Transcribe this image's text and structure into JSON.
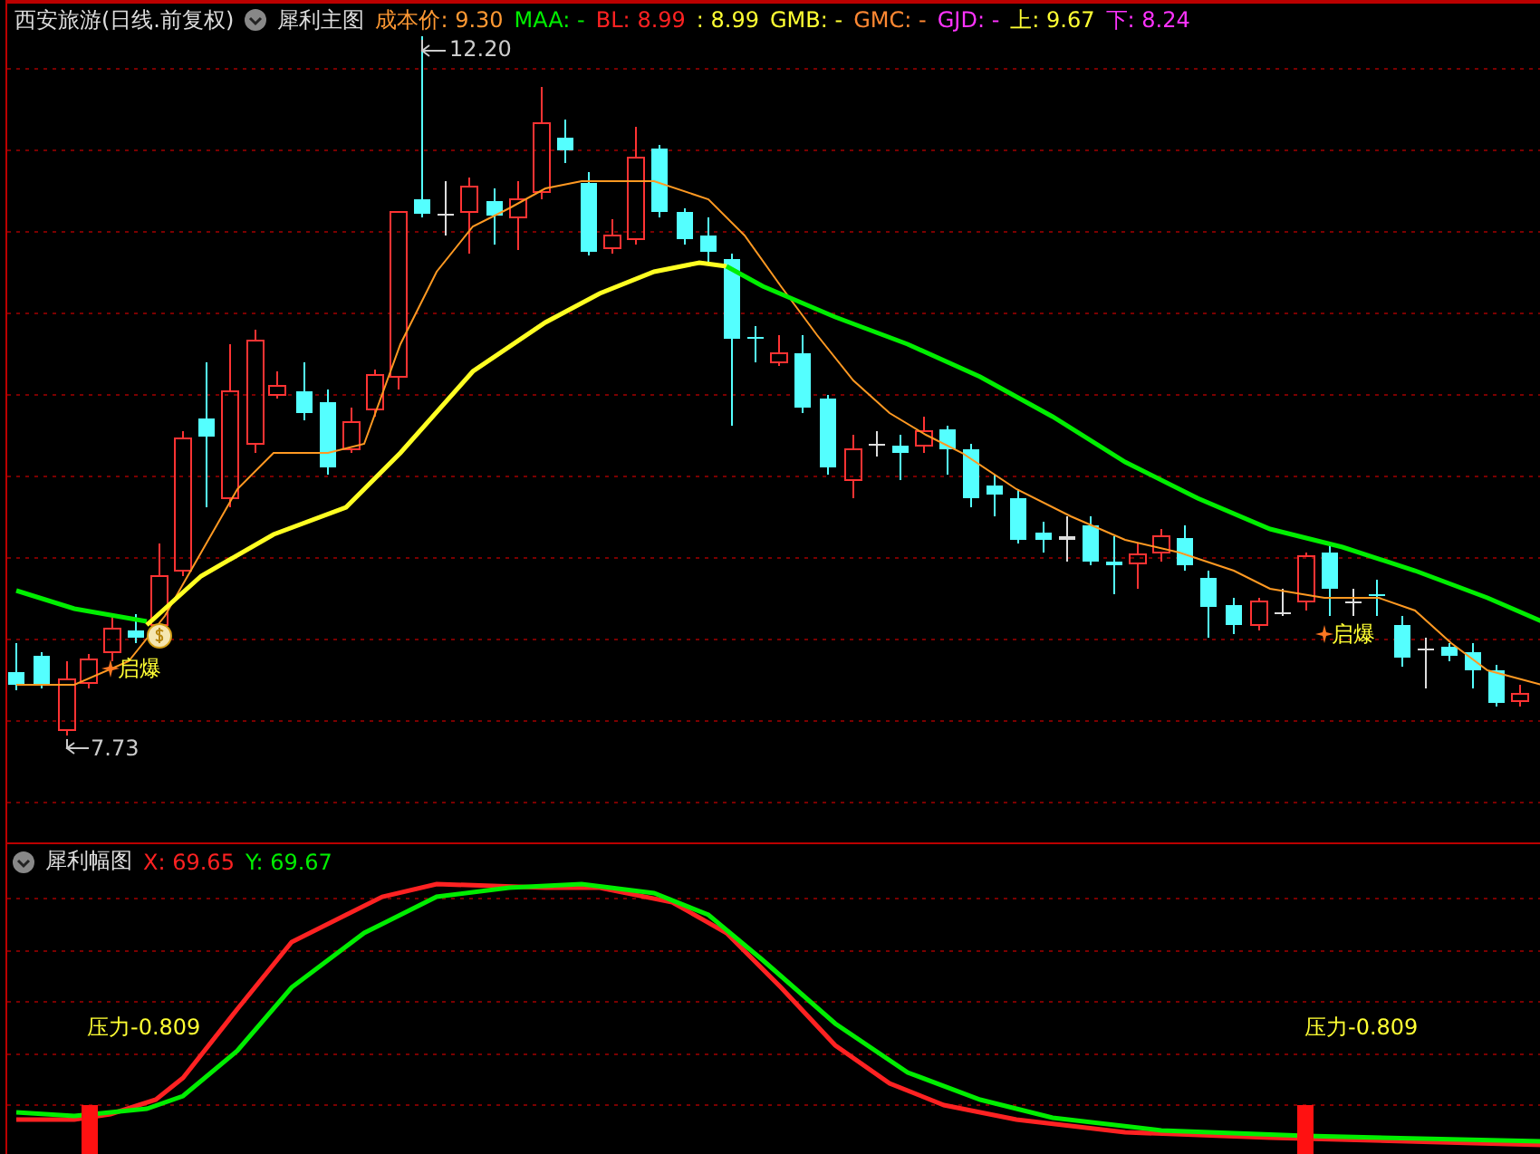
{
  "header": {
    "security": "西安旅游(日线.前复权)",
    "indicator": "犀利主图",
    "items": [
      {
        "label": "成本价:",
        "value": "9.30",
        "color": "#ff9933"
      },
      {
        "label": "MAA:",
        "value": "-",
        "color": "#00ee00"
      },
      {
        "label": "BL:",
        "value": "8.99",
        "color": "#ff2222"
      },
      {
        "label": ":",
        "value": "8.99",
        "color": "#ffff33"
      },
      {
        "label": "GMB:",
        "value": "-",
        "color": "#ffff33"
      },
      {
        "label": "GMC:",
        "value": "-",
        "color": "#ff8833"
      },
      {
        "label": "GJD:",
        "value": "-",
        "color": "#ff33ff"
      },
      {
        "label": "上:",
        "value": "9.67",
        "color": "#ffff33"
      },
      {
        "label": "下:",
        "value": "8.24",
        "color": "#ff33ff"
      }
    ]
  },
  "main_chart": {
    "high_label": "12.20",
    "low_label": "7.73",
    "signals": [
      "启爆",
      "启爆"
    ]
  },
  "sub_chart": {
    "title": "犀利幅图",
    "readings": [
      {
        "label": "X:",
        "value": "69.65",
        "color": "#ff2222"
      },
      {
        "label": "Y:",
        "value": "69.67",
        "color": "#00ee00"
      }
    ],
    "pressure_labels": [
      "压力-0.809",
      "压力-0.809"
    ]
  }
}
